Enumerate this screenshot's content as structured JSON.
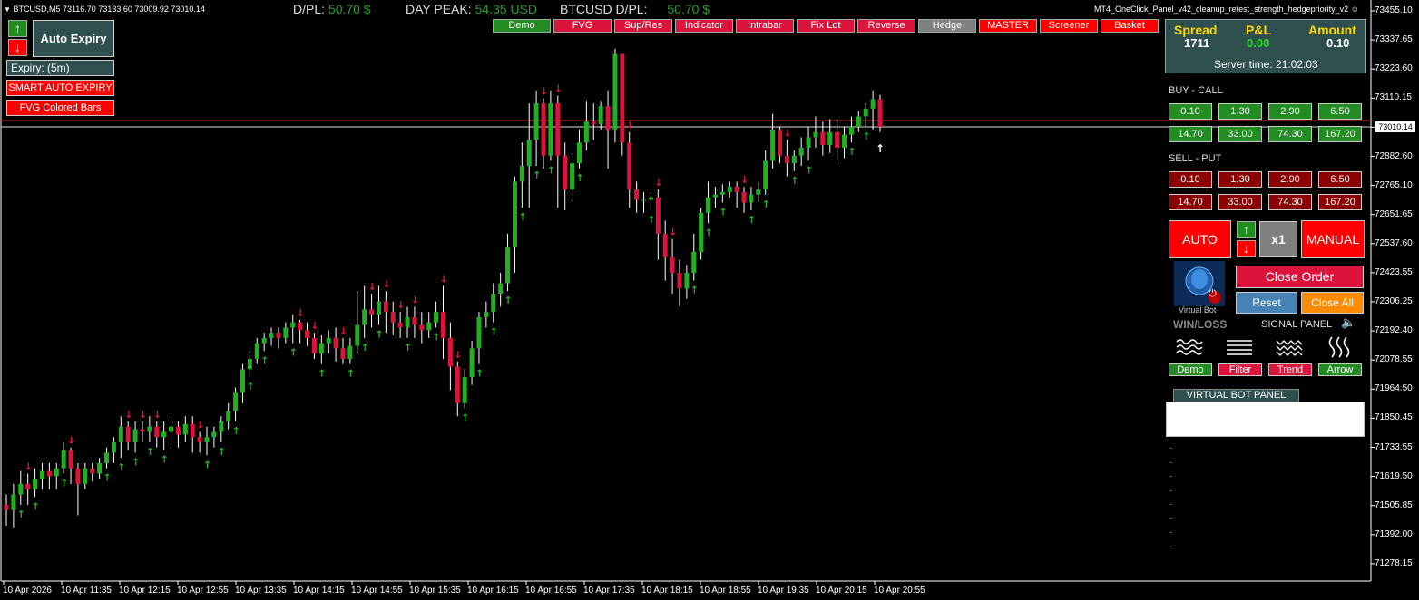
{
  "header": {
    "symbol_info": "BTCUSD,M5  73116.70 73133.60 73009.92 73010.14",
    "dpl_label": "D/PL:",
    "dpl_value": "50.70 $",
    "day_peak_label": "DAY PEAK:",
    "day_peak_value": "54.35 USD",
    "sym_dpl_label": "BTCUSD D/PL:",
    "sym_dpl_value": "50.70 $",
    "ea_name": "MT4_OneClick_Panel_v42_cleanup_retest_strength_hedgepriority_v2"
  },
  "toolbar": [
    {
      "label": "Demo",
      "color": "#228b22"
    },
    {
      "label": "FVG",
      "color": "#dc143c"
    },
    {
      "label": "Sup/Res",
      "color": "#dc143c"
    },
    {
      "label": "Indicator",
      "color": "#dc143c"
    },
    {
      "label": "Intrabar",
      "color": "#dc143c"
    },
    {
      "label": "Fix Lot",
      "color": "#dc143c"
    },
    {
      "label": "Reverse",
      "color": "#dc143c"
    },
    {
      "label": "Hedge",
      "color": "#808080"
    },
    {
      "label": "MASTER",
      "color": "#ff0000"
    },
    {
      "label": "Screener",
      "color": "#ff0000"
    },
    {
      "label": "Basket",
      "color": "#ff0000"
    }
  ],
  "left_panel": {
    "up_arrow": "↑",
    "down_arrow": "↓",
    "auto_expiry": "Auto Expiry",
    "expiry": "Expiry: (5m)",
    "smart_auto_expiry": "SMART AUTO EXPIRY",
    "fvg_colored_bars": "FVG Colored Bars"
  },
  "stats": {
    "spread_label": "Spread",
    "spread_value": "1711",
    "pl_label": "P&L",
    "pl_value": "0.00",
    "amount_label": "Amount",
    "amount_value": "0.10",
    "server_time": "Server time: 21:02:03"
  },
  "buy": {
    "title": "BUY - CALL",
    "amounts": [
      "0.10",
      "1.30",
      "2.90",
      "6.50",
      "14.70",
      "33.00",
      "74.30",
      "167.20"
    ]
  },
  "sell": {
    "title": "SELL - PUT",
    "amounts": [
      "0.10",
      "1.30",
      "2.90",
      "6.50",
      "14.70",
      "33.00",
      "74.30",
      "167.20"
    ]
  },
  "controls": {
    "auto": "AUTO",
    "manual": "MANUAL",
    "multiplier": "x1",
    "up": "↑",
    "down": "↓",
    "virtual_bot": "Virtual Bot",
    "close_order": "Close Order",
    "reset": "Reset",
    "close_all": "Close All",
    "win_loss": "WIN/LOSS",
    "signal_panel": "SIGNAL PANEL",
    "bottom_buttons": [
      {
        "label": "Demo",
        "color": "#228b22"
      },
      {
        "label": "Filter",
        "color": "#dc143c"
      },
      {
        "label": "Trend",
        "color": "#dc143c"
      },
      {
        "label": "Arrow",
        "color": "#228b22"
      }
    ],
    "virtual_bot_panel": "VIRTUAL BOT PANEL",
    "dash": "-"
  },
  "price_axis": {
    "labels": [
      "73455.10",
      "73337.65",
      "73223.60",
      "73110.15",
      "72996.70",
      "72882.60",
      "72765.10",
      "72651.65",
      "72537.60",
      "72423.55",
      "72306.25",
      "72192.40",
      "72078.55",
      "71964.50",
      "71850.45",
      "71733.55",
      "71619.50",
      "71505.85",
      "71392.00",
      "71278.15"
    ],
    "current_price": "73010.14"
  },
  "time_axis": {
    "labels": [
      "10 Apr 2026",
      "10 Apr 11:35",
      "10 Apr 12:15",
      "10 Apr 12:55",
      "10 Apr 13:35",
      "10 Apr 14:15",
      "10 Apr 14:55",
      "10 Apr 15:35",
      "10 Apr 16:15",
      "10 Apr 16:55",
      "10 Apr 17:35",
      "10 Apr 18:15",
      "10 Apr 18:55",
      "10 Apr 19:35",
      "10 Apr 20:15",
      "10 Apr 20:55"
    ]
  },
  "colors": {
    "bull": "#22b022",
    "bear": "#dc143c",
    "price_line": "#cc2020"
  },
  "candles": [
    [
      71560,
      71540,
      71480,
      71600
    ],
    [
      71540,
      71600,
      71470,
      71640
    ],
    [
      71600,
      71640,
      71560,
      71690
    ],
    [
      71640,
      71620,
      71560,
      71680
    ],
    [
      71620,
      71660,
      71590,
      71700
    ],
    [
      71660,
      71690,
      71620,
      71720
    ],
    [
      71690,
      71670,
      71620,
      71720
    ],
    [
      71670,
      71700,
      71620,
      71720
    ],
    [
      71700,
      71770,
      71680,
      71800
    ],
    [
      71770,
      71700,
      71640,
      71780
    ],
    [
      71700,
      71640,
      71520,
      71720
    ],
    [
      71640,
      71700,
      71620,
      71720
    ],
    [
      71700,
      71680,
      71650,
      71720
    ],
    [
      71680,
      71720,
      71660,
      71740
    ],
    [
      71720,
      71760,
      71700,
      71780
    ],
    [
      71760,
      71800,
      71720,
      71820
    ],
    [
      71800,
      71860,
      71740,
      71900
    ],
    [
      71860,
      71800,
      71770,
      71880
    ],
    [
      71800,
      71850,
      71760,
      71880
    ],
    [
      71850,
      71840,
      71800,
      71880
    ],
    [
      71840,
      71860,
      71800,
      71900
    ],
    [
      71860,
      71820,
      71780,
      71880
    ],
    [
      71820,
      71840,
      71770,
      71880
    ],
    [
      71840,
      71860,
      71790,
      71900
    ],
    [
      71860,
      71830,
      71780,
      71880
    ],
    [
      71830,
      71870,
      71800,
      71900
    ],
    [
      71870,
      71820,
      71760,
      71900
    ],
    [
      71820,
      71800,
      71760,
      71840
    ],
    [
      71800,
      71820,
      71750,
      71860
    ],
    [
      71820,
      71840,
      71780,
      71860
    ],
    [
      71840,
      71880,
      71800,
      71900
    ],
    [
      71880,
      71920,
      71850,
      71950
    ],
    [
      71920,
      71990,
      71880,
      72010
    ],
    [
      71990,
      72080,
      71950,
      72100
    ],
    [
      72080,
      72120,
      72050,
      72150
    ],
    [
      72120,
      72180,
      72100,
      72200
    ],
    [
      72180,
      72200,
      72150,
      72220
    ],
    [
      72200,
      72220,
      72170,
      72240
    ],
    [
      72220,
      72200,
      72160,
      72240
    ],
    [
      72200,
      72240,
      72180,
      72260
    ],
    [
      72240,
      72260,
      72180,
      72290
    ],
    [
      72260,
      72230,
      72180,
      72270
    ],
    [
      72230,
      72200,
      72170,
      72260
    ],
    [
      72200,
      72140,
      72120,
      72220
    ],
    [
      72140,
      72180,
      72100,
      72210
    ],
    [
      72180,
      72200,
      72140,
      72230
    ],
    [
      72200,
      72160,
      72110,
      72240
    ],
    [
      72160,
      72120,
      72100,
      72200
    ],
    [
      72120,
      72170,
      72100,
      72200
    ],
    [
      72170,
      72250,
      72140,
      72380
    ],
    [
      72250,
      72310,
      72200,
      72400
    ],
    [
      72310,
      72290,
      72240,
      72370
    ],
    [
      72290,
      72340,
      72250,
      72400
    ],
    [
      72340,
      72300,
      72220,
      72380
    ],
    [
      72300,
      72260,
      72210,
      72340
    ],
    [
      72260,
      72240,
      72200,
      72300
    ],
    [
      72240,
      72280,
      72200,
      72320
    ],
    [
      72280,
      72250,
      72200,
      72320
    ],
    [
      72250,
      72230,
      72180,
      72300
    ],
    [
      72230,
      72260,
      72200,
      72300
    ],
    [
      72260,
      72300,
      72240,
      72340
    ],
    [
      72300,
      72200,
      72120,
      72400
    ],
    [
      72200,
      72090,
      72000,
      72260
    ],
    [
      72090,
      71950,
      71900,
      72110
    ],
    [
      71950,
      72050,
      71930,
      72080
    ],
    [
      72050,
      72160,
      72020,
      72190
    ],
    [
      72160,
      72280,
      72100,
      72300
    ],
    [
      72280,
      72300,
      72240,
      72340
    ],
    [
      72300,
      72370,
      72260,
      72410
    ],
    [
      72370,
      72410,
      72320,
      72450
    ],
    [
      72410,
      72550,
      72380,
      72600
    ],
    [
      72550,
      72800,
      72450,
      72820
    ],
    [
      72800,
      72860,
      72700,
      72950
    ],
    [
      72860,
      72960,
      72700,
      73100
    ],
    [
      72960,
      73100,
      72860,
      73150
    ],
    [
      73100,
      72900,
      72850,
      73120
    ],
    [
      72900,
      73100,
      72880,
      73150
    ],
    [
      73100,
      72900,
      72700,
      73130
    ],
    [
      72900,
      72770,
      72690,
      72950
    ],
    [
      72770,
      72870,
      72720,
      72910
    ],
    [
      72870,
      72950,
      72850,
      73000
    ],
    [
      72950,
      73030,
      72920,
      73110
    ],
    [
      73030,
      73020,
      72960,
      73100
    ],
    [
      73020,
      73090,
      73000,
      73110
    ],
    [
      73090,
      73000,
      72850,
      73150
    ],
    [
      73000,
      73290,
      72950,
      73310
    ],
    [
      73290,
      72950,
      72900,
      73250
    ],
    [
      72950,
      72770,
      72700,
      72990
    ],
    [
      72770,
      72730,
      72680,
      72800
    ],
    [
      72730,
      72730,
      72680,
      72760
    ],
    [
      72730,
      72740,
      72690,
      72760
    ],
    [
      72740,
      72600,
      72500,
      72770
    ],
    [
      72600,
      72510,
      72420,
      72650
    ],
    [
      72510,
      72450,
      72370,
      72580
    ],
    [
      72450,
      72390,
      72320,
      72500
    ],
    [
      72390,
      72450,
      72350,
      72480
    ],
    [
      72450,
      72530,
      72420,
      72600
    ],
    [
      72530,
      72680,
      72500,
      72700
    ],
    [
      72680,
      72740,
      72640,
      72800
    ],
    [
      72740,
      72750,
      72700,
      72780
    ],
    [
      72750,
      72760,
      72720,
      72790
    ],
    [
      72760,
      72780,
      72740,
      72800
    ],
    [
      72780,
      72760,
      72700,
      72800
    ],
    [
      72760,
      72720,
      72680,
      72780
    ],
    [
      72720,
      72750,
      72690,
      72780
    ],
    [
      72750,
      72770,
      72720,
      72800
    ],
    [
      72770,
      72880,
      72750,
      72920
    ],
    [
      72880,
      73000,
      72850,
      73060
    ],
    [
      73000,
      72900,
      72870,
      73010
    ],
    [
      72900,
      72870,
      72820,
      72960
    ],
    [
      72870,
      72900,
      72840,
      72920
    ],
    [
      72900,
      72930,
      72860,
      72970
    ],
    [
      72930,
      72970,
      72880,
      73010
    ],
    [
      72970,
      72990,
      72930,
      73050
    ],
    [
      72990,
      72940,
      72900,
      73030
    ],
    [
      72940,
      72990,
      72910,
      73040
    ],
    [
      72990,
      72930,
      72880,
      73040
    ],
    [
      72930,
      72980,
      72890,
      73010
    ],
    [
      72980,
      73010,
      72950,
      73050
    ],
    [
      73010,
      73050,
      72990,
      73070
    ],
    [
      73050,
      73080,
      73010,
      73100
    ],
    [
      73080,
      73116,
      73000,
      73150
    ],
    [
      73116,
      73010,
      72990,
      73133
    ]
  ]
}
